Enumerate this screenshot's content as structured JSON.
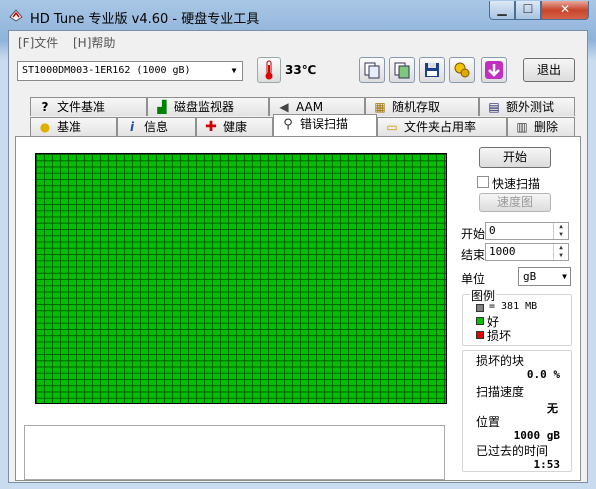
{
  "window": {
    "title": "HD Tune 专业版 v4.60 - 硬盘专业工具"
  },
  "menu": [
    {
      "label": "[F]文件"
    },
    {
      "label": "[H]帮助"
    }
  ],
  "toolbar": {
    "drive": "ST1000DM003-1ER162 (1000 gB)",
    "temperature": "33℃",
    "exit_label": "退出"
  },
  "tabs_top": [
    {
      "label": "文件基准",
      "icon": "tab-file-benchmark-icon",
      "glyph": "?"
    },
    {
      "label": "磁盘监视器",
      "icon": "disk-monitor-icon",
      "glyph": "▟"
    },
    {
      "label": "AAM",
      "icon": "speaker-icon",
      "glyph": "◀"
    },
    {
      "label": "随机存取",
      "icon": "random-access-icon",
      "glyph": "▦"
    },
    {
      "label": "额外测试",
      "icon": "extra-tests-icon",
      "glyph": "▤"
    }
  ],
  "tabs_bottom": [
    {
      "label": "基准",
      "icon": "bulb-icon",
      "glyph": "●"
    },
    {
      "label": "信息",
      "icon": "info-icon",
      "glyph": "i"
    },
    {
      "label": "健康",
      "icon": "health-cross-icon",
      "glyph": "✚"
    },
    {
      "label": "错误扫描",
      "icon": "magnifier-icon",
      "glyph": "⚲"
    },
    {
      "label": "文件夹占用率",
      "icon": "folder-icon",
      "glyph": "▭"
    },
    {
      "label": "删除",
      "icon": "trash-icon",
      "glyph": "▥"
    }
  ],
  "scan": {
    "start_button": "开始",
    "quick_scan_label": "快速扫描",
    "quick_scan_checked": false,
    "speed_map_button": "速度图",
    "start_label": "开始",
    "start_value": "0",
    "end_label": "结束",
    "end_value": "1000",
    "unit_label": "单位",
    "unit_value": "gB",
    "legend_title": "图例",
    "legend_block": "= 381 MB",
    "legend_good": "好",
    "legend_bad": "损坏",
    "damaged_blocks_label": "损坏的块",
    "damaged_blocks_value": "0.0 %",
    "scan_speed_label": "扫描速度",
    "scan_speed_value": "无",
    "position_label": "位置",
    "position_value": "1000 gB",
    "elapsed_label": "已过去的时间",
    "elapsed_value": "1:53"
  },
  "colors": {
    "good": "#00c000",
    "bad": "#e00000",
    "block": "#808080",
    "active_tab_bg": "#ffffff"
  }
}
